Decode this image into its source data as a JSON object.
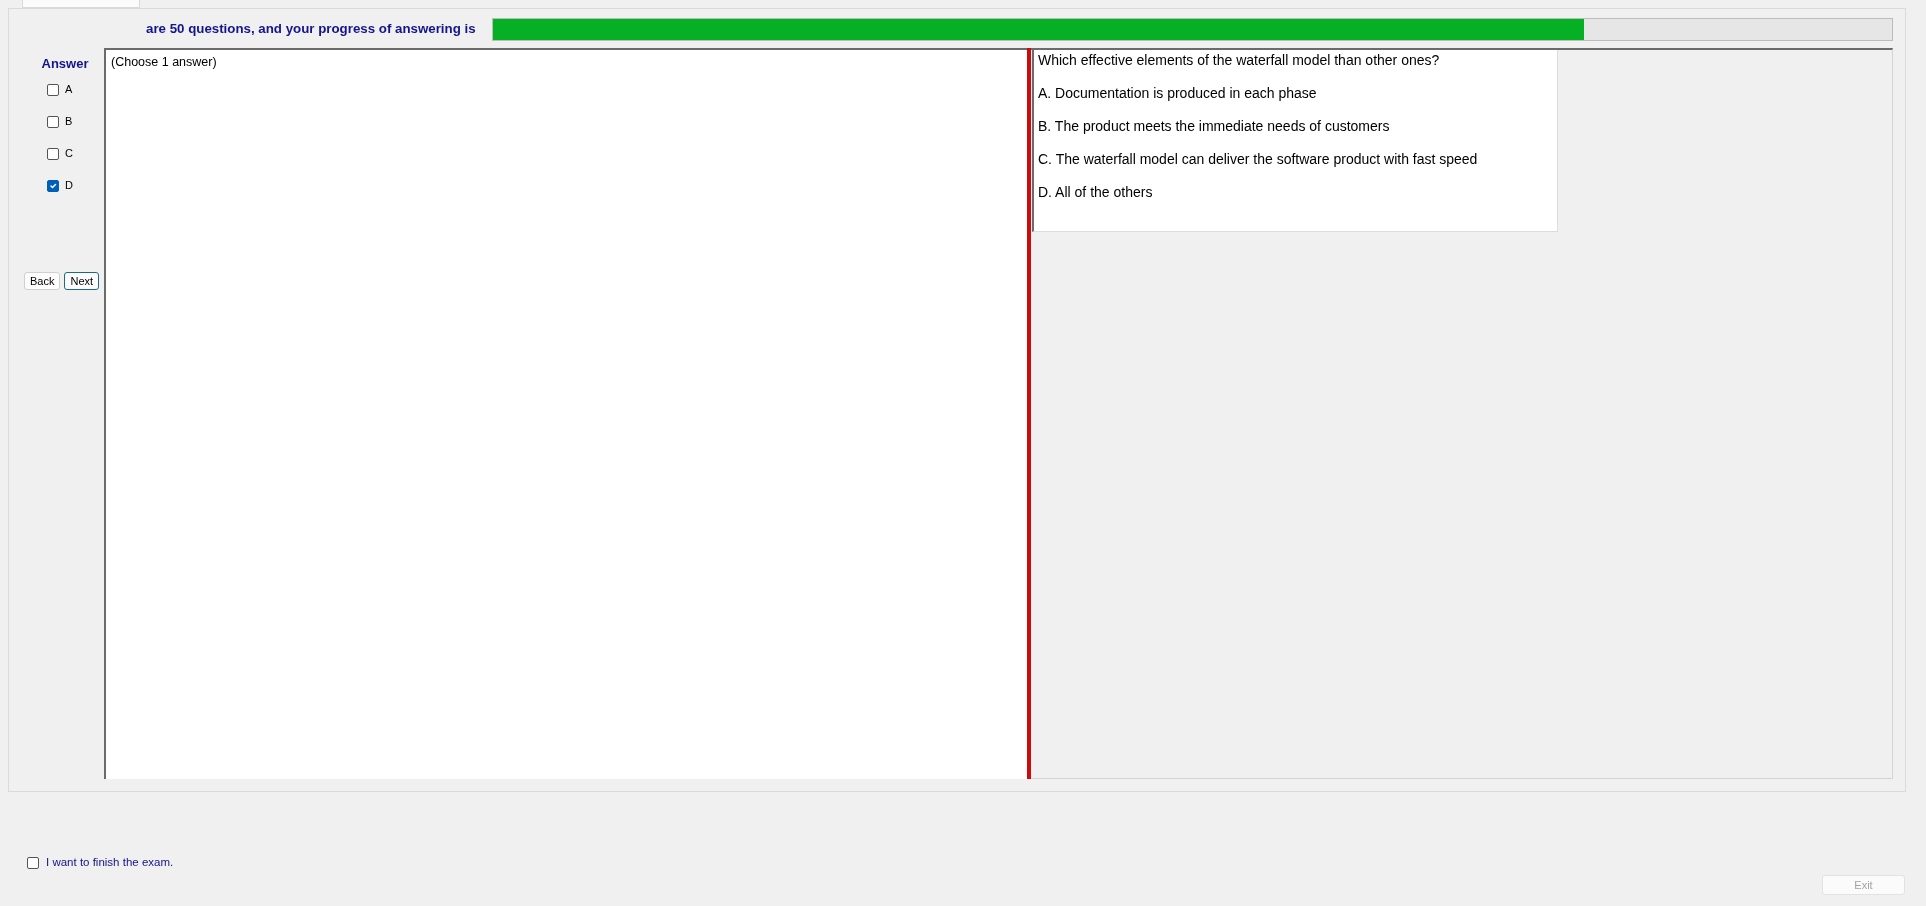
{
  "progress": {
    "label": "are 50 questions, and your progress of answering is",
    "level": 0.78
  },
  "answer_panel": {
    "title": "Answer",
    "options": [
      {
        "label": "A",
        "checked": false
      },
      {
        "label": "B",
        "checked": false
      },
      {
        "label": "C",
        "checked": false
      },
      {
        "label": "D",
        "checked": true
      }
    ],
    "buttons": [
      {
        "label": "Back",
        "focused": false
      },
      {
        "label": "Next",
        "focused": true
      }
    ]
  },
  "instruction": "(Choose 1 answer)",
  "question": {
    "text": "Which effective elements of the waterfall model than other ones?",
    "choices": [
      "A. Documentation is produced in each phase",
      "B. The product meets the immediate needs of customers",
      "C. The waterfall model can deliver the software product with fast speed",
      "D. All of the others"
    ]
  },
  "finish": {
    "label": "I want to finish the exam.",
    "checked": false
  },
  "exit_button": {
    "label": "Exit",
    "disabled": true
  }
}
